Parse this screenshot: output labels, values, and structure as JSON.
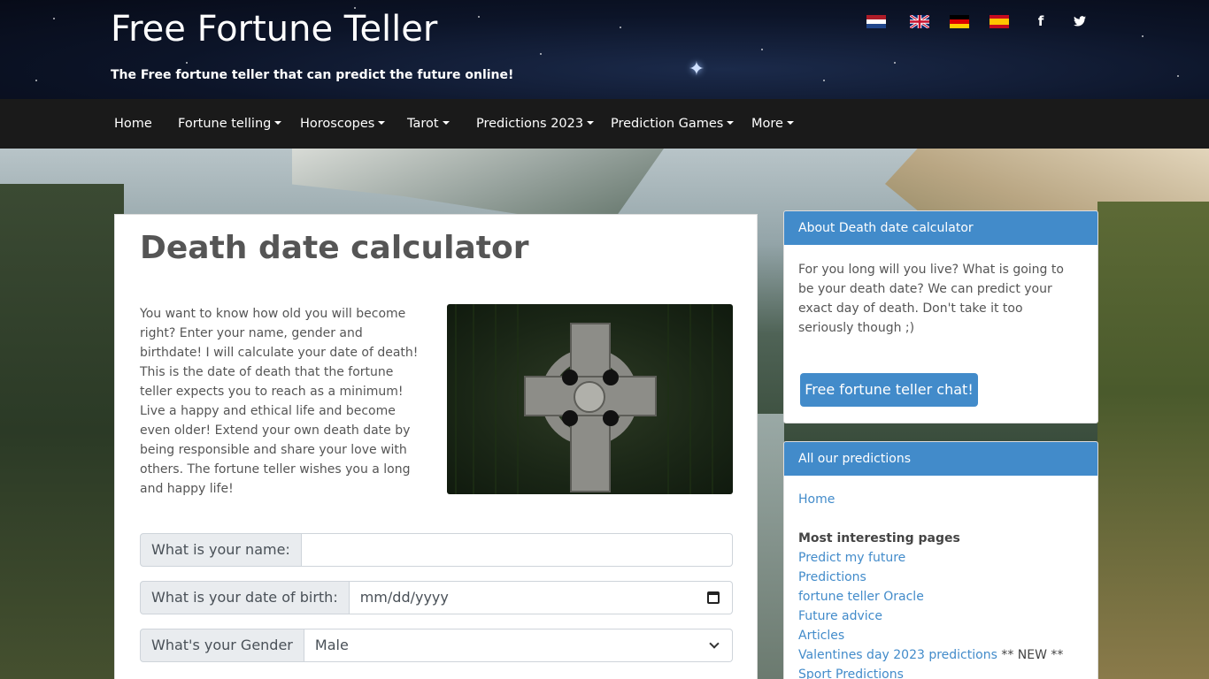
{
  "header": {
    "site_title": "Free Fortune Teller",
    "tagline": "The Free fortune teller that can predict the future online!",
    "languages": [
      "dutch-flag-icon",
      "uk-flag-icon",
      "german-flag-icon",
      "spanish-flag-icon"
    ],
    "social": {
      "facebook": "f",
      "twitter": "t"
    }
  },
  "nav": {
    "items": [
      {
        "label": "Home",
        "dropdown": false
      },
      {
        "label": "Fortune telling",
        "dropdown": true
      },
      {
        "label": "Horoscopes",
        "dropdown": true
      },
      {
        "label": "Tarot",
        "dropdown": true
      },
      {
        "label": "Predictions 2023",
        "dropdown": true
      },
      {
        "label": "Prediction Games",
        "dropdown": true
      },
      {
        "label": "More",
        "dropdown": true
      }
    ]
  },
  "main": {
    "title": "Death date calculator",
    "intro": "You want to know how old you will become right? Enter your name, gender and birthdate! I will calculate your date of death! This is the date of death that the fortune teller expects you to reach as a minimum! Live a happy and ethical life and become even older! Extend your own death date by being responsible and share your love with others. The fortune teller wishes you a long and happy life!",
    "form": {
      "name_label": "What is your name:",
      "name_value": "",
      "dob_label": "What is your date of birth:",
      "dob_placeholder": "mm/dd/yyyy",
      "gender_label": "What's your Gender",
      "gender_value": "Male"
    }
  },
  "sidebar": {
    "about": {
      "heading": "About Death date calculator",
      "text": "For you long will you live? What is going to be your death date? We can predict your exact day of death. Don't take it too seriously though ;)",
      "button": "Free fortune teller chat!"
    },
    "predictions": {
      "heading": "All our predictions",
      "home": "Home",
      "section": "Most interesting pages",
      "links": [
        "Predict my future",
        "Predictions",
        "fortune teller Oracle",
        "Future advice",
        "Articles",
        "Valentines day 2023 predictions",
        "Sport Predictions"
      ],
      "new_tag": " ** NEW **"
    }
  },
  "colors": {
    "accent": "#428bca",
    "nav_bg": "#1a1a1a",
    "header_bg": "#0c1428"
  }
}
